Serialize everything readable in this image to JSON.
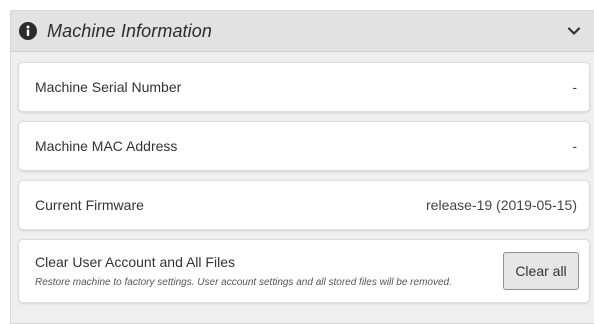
{
  "panel": {
    "title": "Machine Information",
    "icons": {
      "header": "info-icon",
      "toggle": "chevron-down-icon"
    }
  },
  "rows": [
    {
      "label": "Machine Serial Number",
      "value": "-"
    },
    {
      "label": "Machine MAC Address",
      "value": "-"
    },
    {
      "label": "Current Firmware",
      "value": "release-19 (2019-05-15)"
    }
  ],
  "clear": {
    "label": "Clear User Account and All Files",
    "description": "Restore machine to factory settings. User account settings and all stored files will be removed.",
    "button_label": "Clear all"
  }
}
